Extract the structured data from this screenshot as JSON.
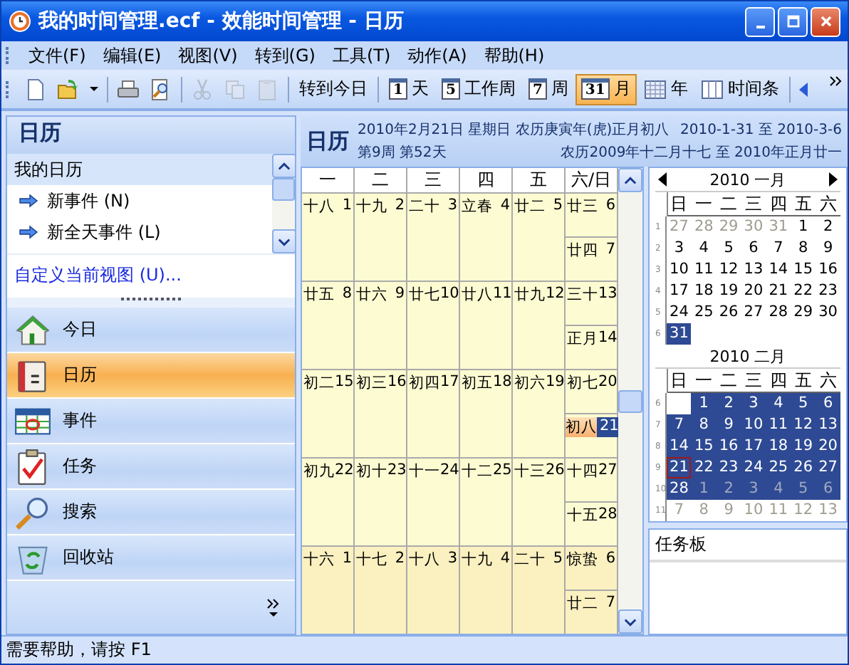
{
  "window": {
    "title": "我的时间管理.ecf - 效能时间管理 - 日历"
  },
  "menu": [
    "文件(F)",
    "编辑(E)",
    "视图(V)",
    "转到(G)",
    "工具(T)",
    "动作(A)",
    "帮助(H)"
  ],
  "toolbar": {
    "icon_buttons": [
      {
        "kind": "new",
        "disabled": false
      },
      {
        "kind": "open",
        "disabled": false
      },
      {
        "kind": "dropdown",
        "disabled": false
      },
      {
        "kind": "print",
        "disabled": false
      },
      {
        "kind": "preview",
        "disabled": false
      },
      {
        "kind": "cut",
        "disabled": true
      },
      {
        "kind": "copy",
        "disabled": true
      },
      {
        "kind": "paste",
        "disabled": true
      }
    ],
    "goto_today": "转到今日",
    "views": [
      {
        "badge": "1",
        "label": "天",
        "selected": false
      },
      {
        "badge": "5",
        "label": "工作周",
        "selected": false
      },
      {
        "badge": "7",
        "label": "周",
        "selected": false
      },
      {
        "badge": "31",
        "label": "月",
        "selected": true
      },
      {
        "kind": "grid",
        "label": "年",
        "selected": false
      },
      {
        "kind": "columns",
        "label": "时间条",
        "selected": false
      }
    ]
  },
  "sidebar": {
    "title": "日历",
    "section": "我的日历",
    "actions": [
      "新事件 (N)",
      "新全天事件 (L)"
    ],
    "link": "自定义当前视图 (U)...",
    "nav": [
      {
        "kind": "home",
        "label": "今日",
        "selected": false
      },
      {
        "kind": "calendar",
        "label": "日历",
        "selected": true
      },
      {
        "kind": "events",
        "label": "事件",
        "selected": false
      },
      {
        "kind": "tasks",
        "label": "任务",
        "selected": false
      },
      {
        "kind": "search",
        "label": "搜索",
        "selected": false
      },
      {
        "kind": "recycle",
        "label": "回收站",
        "selected": false
      }
    ]
  },
  "calendar": {
    "title": "日历",
    "date_line": "2010年2月21日 星期日 农历庚寅年(虎)正月初八",
    "range": "2010-1-31 至 2010-3-6",
    "week_line": "第9周 第52天",
    "lunar_range": "农历2009年十二月十七 至 2010年正月廿一",
    "weekdays": [
      "一",
      "二",
      "三",
      "四",
      "五",
      "六/日"
    ],
    "weeks": [
      {
        "days": [
          {
            "lunar": "十八",
            "day": "1",
            "selected": false,
            "other_month": false
          },
          {
            "lunar": "十九",
            "day": "2",
            "selected": false,
            "other_month": false
          },
          {
            "lunar": "二十",
            "day": "3",
            "selected": false,
            "other_month": false
          },
          {
            "lunar": "立春",
            "day": "4",
            "selected": false,
            "other_month": false
          },
          {
            "lunar": "廿二",
            "day": "5",
            "selected": false,
            "other_month": false
          },
          {
            "lunar": "廿三",
            "day": "6",
            "selected": false,
            "other_month": false
          },
          {
            "lunar": "廿四",
            "day": "7",
            "selected": false,
            "other_month": false
          }
        ]
      },
      {
        "days": [
          {
            "lunar": "廿五",
            "day": "8",
            "selected": false,
            "other_month": false
          },
          {
            "lunar": "廿六",
            "day": "9",
            "selected": false,
            "other_month": false
          },
          {
            "lunar": "廿七",
            "day": "10",
            "selected": false,
            "other_month": false
          },
          {
            "lunar": "廿八",
            "day": "11",
            "selected": false,
            "other_month": false
          },
          {
            "lunar": "廿九",
            "day": "12",
            "selected": false,
            "other_month": false
          },
          {
            "lunar": "三十",
            "day": "13",
            "selected": false,
            "other_month": false
          },
          {
            "lunar": "正月",
            "day": "14",
            "selected": false,
            "other_month": false
          }
        ]
      },
      {
        "days": [
          {
            "lunar": "初二",
            "day": "15",
            "selected": false,
            "other_month": false
          },
          {
            "lunar": "初三",
            "day": "16",
            "selected": false,
            "other_month": false
          },
          {
            "lunar": "初四",
            "day": "17",
            "selected": false,
            "other_month": false
          },
          {
            "lunar": "初五",
            "day": "18",
            "selected": false,
            "other_month": false
          },
          {
            "lunar": "初六",
            "day": "19",
            "selected": false,
            "other_month": false
          },
          {
            "lunar": "初七",
            "day": "20",
            "selected": false,
            "other_month": false
          },
          {
            "lunar": "初八",
            "day": "21",
            "selected": true,
            "other_month": false
          }
        ]
      },
      {
        "days": [
          {
            "lunar": "初九",
            "day": "22",
            "selected": false,
            "other_month": false
          },
          {
            "lunar": "初十",
            "day": "23",
            "selected": false,
            "other_month": false
          },
          {
            "lunar": "十一",
            "day": "24",
            "selected": false,
            "other_month": false
          },
          {
            "lunar": "十二",
            "day": "25",
            "selected": false,
            "other_month": false
          },
          {
            "lunar": "十三",
            "day": "26",
            "selected": false,
            "other_month": false
          },
          {
            "lunar": "十四",
            "day": "27",
            "selected": false,
            "other_month": false
          },
          {
            "lunar": "十五",
            "day": "28",
            "selected": false,
            "other_month": false
          }
        ]
      },
      {
        "days": [
          {
            "lunar": "十六",
            "day": "1",
            "selected": false,
            "other_month": true
          },
          {
            "lunar": "十七",
            "day": "2",
            "selected": false,
            "other_month": true
          },
          {
            "lunar": "十八",
            "day": "3",
            "selected": false,
            "other_month": true
          },
          {
            "lunar": "十九",
            "day": "4",
            "selected": false,
            "other_month": true
          },
          {
            "lunar": "二十",
            "day": "5",
            "selected": false,
            "other_month": true
          },
          {
            "lunar": "惊蛰",
            "day": "6",
            "selected": false,
            "other_month": true
          },
          {
            "lunar": "廿二",
            "day": "7",
            "selected": false,
            "other_month": true
          }
        ]
      }
    ]
  },
  "mini_calendars": [
    {
      "title": "2010 一月",
      "arrows": true,
      "weekdays": [
        "日",
        "一",
        "二",
        "三",
        "四",
        "五",
        "六"
      ],
      "weeks": [
        {
          "number": "1",
          "days": [
            {
              "day": "27",
              "muted": true,
              "highlighted": false,
              "today": false
            },
            {
              "day": "28",
              "muted": true,
              "highlighted": false,
              "today": false
            },
            {
              "day": "29",
              "muted": true,
              "highlighted": false,
              "today": false
            },
            {
              "day": "30",
              "muted": true,
              "highlighted": false,
              "today": false
            },
            {
              "day": "31",
              "muted": true,
              "highlighted": false,
              "today": false
            },
            {
              "day": "1",
              "muted": false,
              "highlighted": false,
              "today": false
            },
            {
              "day": "2",
              "muted": false,
              "highlighted": false,
              "today": false
            }
          ]
        },
        {
          "number": "2",
          "days": [
            {
              "day": "3",
              "muted": false,
              "highlighted": false,
              "today": false
            },
            {
              "day": "4",
              "muted": false,
              "highlighted": false,
              "today": false
            },
            {
              "day": "5",
              "muted": false,
              "highlighted": false,
              "today": false
            },
            {
              "day": "6",
              "muted": false,
              "highlighted": false,
              "today": false
            },
            {
              "day": "7",
              "muted": false,
              "highlighted": false,
              "today": false
            },
            {
              "day": "8",
              "muted": false,
              "highlighted": false,
              "today": false
            },
            {
              "day": "9",
              "muted": false,
              "highlighted": false,
              "today": false
            }
          ]
        },
        {
          "number": "3",
          "days": [
            {
              "day": "10",
              "muted": false,
              "highlighted": false,
              "today": false
            },
            {
              "day": "11",
              "muted": false,
              "highlighted": false,
              "today": false
            },
            {
              "day": "12",
              "muted": false,
              "highlighted": false,
              "today": false
            },
            {
              "day": "13",
              "muted": false,
              "highlighted": false,
              "today": false
            },
            {
              "day": "14",
              "muted": false,
              "highlighted": false,
              "today": false
            },
            {
              "day": "15",
              "muted": false,
              "highlighted": false,
              "today": false
            },
            {
              "day": "16",
              "muted": false,
              "highlighted": false,
              "today": false
            }
          ]
        },
        {
          "number": "4",
          "days": [
            {
              "day": "17",
              "muted": false,
              "highlighted": false,
              "today": false
            },
            {
              "day": "18",
              "muted": false,
              "highlighted": false,
              "today": false
            },
            {
              "day": "19",
              "muted": false,
              "highlighted": false,
              "today": false
            },
            {
              "day": "20",
              "muted": false,
              "highlighted": false,
              "today": false
            },
            {
              "day": "21",
              "muted": false,
              "highlighted": false,
              "today": false
            },
            {
              "day": "22",
              "muted": false,
              "highlighted": false,
              "today": false
            },
            {
              "day": "23",
              "muted": false,
              "highlighted": false,
              "today": false
            }
          ]
        },
        {
          "number": "5",
          "days": [
            {
              "day": "24",
              "muted": false,
              "highlighted": false,
              "today": false
            },
            {
              "day": "25",
              "muted": false,
              "highlighted": false,
              "today": false
            },
            {
              "day": "26",
              "muted": false,
              "highlighted": false,
              "today": false
            },
            {
              "day": "27",
              "muted": false,
              "highlighted": false,
              "today": false
            },
            {
              "day": "28",
              "muted": false,
              "highlighted": false,
              "today": false
            },
            {
              "day": "29",
              "muted": false,
              "highlighted": false,
              "today": false
            },
            {
              "day": "30",
              "muted": false,
              "highlighted": false,
              "today": false
            }
          ]
        },
        {
          "number": "6",
          "days": [
            {
              "day": "31",
              "muted": false,
              "highlighted": true,
              "today": false
            }
          ]
        }
      ]
    },
    {
      "title": "2010 二月",
      "arrows": false,
      "weekdays": [
        "日",
        "一",
        "二",
        "三",
        "四",
        "五",
        "六"
      ],
      "weeks": [
        {
          "number": "6",
          "leading_blank": true,
          "days": [
            {
              "day": "1",
              "muted": false,
              "highlighted": true,
              "today": false
            },
            {
              "day": "2",
              "muted": false,
              "highlighted": true,
              "today": false
            },
            {
              "day": "3",
              "muted": false,
              "highlighted": true,
              "today": false
            },
            {
              "day": "4",
              "muted": false,
              "highlighted": true,
              "today": false
            },
            {
              "day": "5",
              "muted": false,
              "highlighted": true,
              "today": false
            },
            {
              "day": "6",
              "muted": false,
              "highlighted": true,
              "today": false
            }
          ]
        },
        {
          "number": "7",
          "days": [
            {
              "day": "7",
              "muted": false,
              "highlighted": true,
              "today": false
            },
            {
              "day": "8",
              "muted": false,
              "highlighted": true,
              "today": false
            },
            {
              "day": "9",
              "muted": false,
              "highlighted": true,
              "today": false
            },
            {
              "day": "10",
              "muted": false,
              "highlighted": true,
              "today": false
            },
            {
              "day": "11",
              "muted": false,
              "highlighted": true,
              "today": false
            },
            {
              "day": "12",
              "muted": false,
              "highlighted": true,
              "today": false
            },
            {
              "day": "13",
              "muted": false,
              "highlighted": true,
              "today": false
            }
          ]
        },
        {
          "number": "8",
          "days": [
            {
              "day": "14",
              "muted": false,
              "highlighted": true,
              "today": false
            },
            {
              "day": "15",
              "muted": false,
              "highlighted": true,
              "today": false
            },
            {
              "day": "16",
              "muted": false,
              "highlighted": true,
              "today": false
            },
            {
              "day": "17",
              "muted": false,
              "highlighted": true,
              "today": false
            },
            {
              "day": "18",
              "muted": false,
              "highlighted": true,
              "today": false
            },
            {
              "day": "19",
              "muted": false,
              "highlighted": true,
              "today": false
            },
            {
              "day": "20",
              "muted": false,
              "highlighted": true,
              "today": false
            }
          ]
        },
        {
          "number": "9",
          "days": [
            {
              "day": "21",
              "muted": false,
              "highlighted": true,
              "today": true
            },
            {
              "day": "22",
              "muted": false,
              "highlighted": true,
              "today": false
            },
            {
              "day": "23",
              "muted": false,
              "highlighted": true,
              "today": false
            },
            {
              "day": "24",
              "muted": false,
              "highlighted": true,
              "today": false
            },
            {
              "day": "25",
              "muted": false,
              "highlighted": true,
              "today": false
            },
            {
              "day": "26",
              "muted": false,
              "highlighted": true,
              "today": false
            },
            {
              "day": "27",
              "muted": false,
              "highlighted": true,
              "today": false
            }
          ]
        },
        {
          "number": "10",
          "days": [
            {
              "day": "28",
              "muted": false,
              "highlighted": true,
              "today": false
            },
            {
              "day": "1",
              "muted": true,
              "highlighted": true,
              "today": false
            },
            {
              "day": "2",
              "muted": true,
              "highlighted": true,
              "today": false
            },
            {
              "day": "3",
              "muted": true,
              "highlighted": true,
              "today": false
            },
            {
              "day": "4",
              "muted": true,
              "highlighted": true,
              "today": false
            },
            {
              "day": "5",
              "muted": true,
              "highlighted": true,
              "today": false
            },
            {
              "day": "6",
              "muted": true,
              "highlighted": true,
              "today": false
            }
          ]
        },
        {
          "number": "11",
          "days": [
            {
              "day": "7",
              "muted": true,
              "highlighted": false,
              "today": false
            },
            {
              "day": "8",
              "muted": true,
              "highlighted": false,
              "today": false
            },
            {
              "day": "9",
              "muted": true,
              "highlighted": false,
              "today": false
            },
            {
              "day": "10",
              "muted": true,
              "highlighted": false,
              "today": false
            },
            {
              "day": "11",
              "muted": true,
              "highlighted": false,
              "today": false
            },
            {
              "day": "12",
              "muted": true,
              "highlighted": false,
              "today": false
            },
            {
              "day": "13",
              "muted": true,
              "highlighted": false,
              "today": false
            }
          ]
        }
      ]
    }
  ],
  "task_board": {
    "title": "任务板"
  },
  "status_bar": "需要帮助，请按 F1"
}
